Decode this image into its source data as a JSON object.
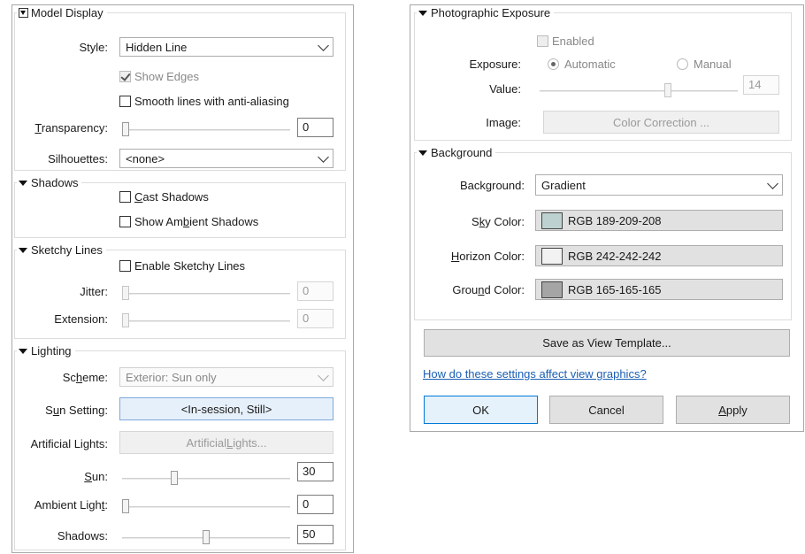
{
  "left": {
    "model_display": {
      "title": "Model Display",
      "style_label": "Style:",
      "style_value": "Hidden Line",
      "show_edges": "Show Edges",
      "smooth_lines": "Smooth lines with anti-aliasing",
      "transparency_label": "Transparency:",
      "transparency_value": "0",
      "silhouettes_label": "Silhouettes:",
      "silhouettes_value": "<none>"
    },
    "shadows": {
      "title": "Shadows",
      "cast": "Cast Shadows",
      "ambient": "Show Ambient Shadows"
    },
    "sketchy": {
      "title": "Sketchy Lines",
      "enable": "Enable Sketchy Lines",
      "jitter_label": "Jitter:",
      "jitter_value": "0",
      "extension_label": "Extension:",
      "extension_value": "0"
    },
    "lighting": {
      "title": "Lighting",
      "scheme_label": "Scheme:",
      "scheme_value": "Exterior: Sun only",
      "sun_setting_label": "Sun Setting:",
      "sun_setting_value": "<In-session, Still>",
      "artificial_label": "Artificial Lights:",
      "artificial_button": "Artificial Lights...",
      "sun_label": "Sun:",
      "sun_value": "30",
      "sun_level": 30,
      "ambient_label": "Ambient Light:",
      "ambient_value": "0",
      "ambient_level": 0,
      "shadows_label": "Shadows:",
      "shadows_value": "50",
      "shadows_level": 50
    }
  },
  "right": {
    "exposure": {
      "title": "Photographic Exposure",
      "enabled": "Enabled",
      "exposure_label": "Exposure:",
      "automatic": "Automatic",
      "manual": "Manual",
      "value_label": "Value:",
      "value": "14",
      "image_label": "Image:",
      "color_correction": "Color Correction ..."
    },
    "background": {
      "title": "Background",
      "bg_label": "Background:",
      "bg_value": "Gradient",
      "sky_label": "Sky Color:",
      "sky_value": "RGB 189-209-208",
      "sky_color": "#bdd1d0",
      "horizon_label": "Horizon Color:",
      "horizon_value": "RGB 242-242-242",
      "horizon_color": "#f2f2f2",
      "ground_label": "Ground Color:",
      "ground_value": "RGB 165-165-165",
      "ground_color": "#a5a5a5"
    },
    "save_template": "Save as View Template...",
    "help_link": "How do these settings affect view graphics?",
    "ok": "OK",
    "cancel": "Cancel",
    "apply": "Apply"
  }
}
